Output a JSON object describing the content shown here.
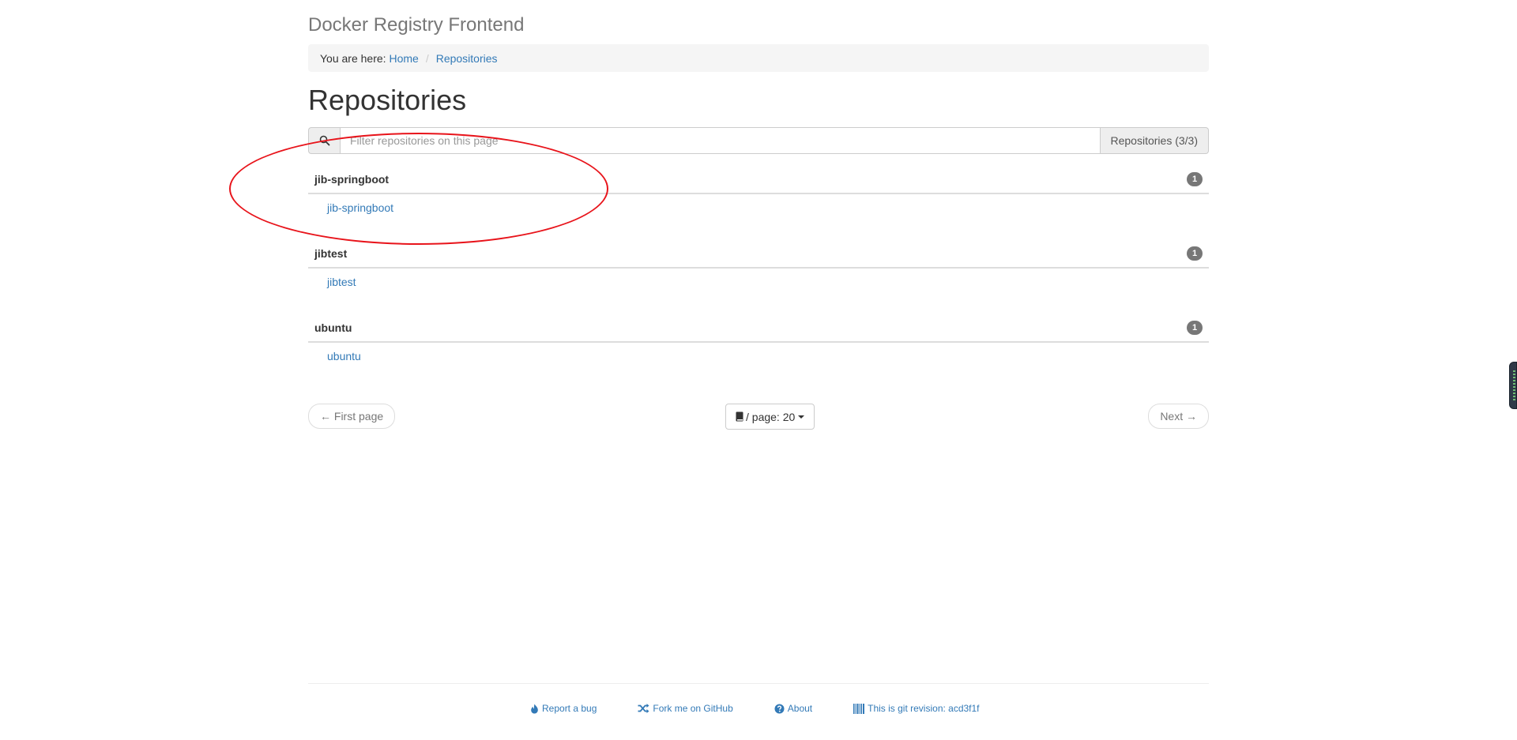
{
  "app": {
    "title": "Docker Registry Frontend"
  },
  "breadcrumb": {
    "prefix": "You are here:",
    "items": [
      "Home",
      "Repositories"
    ],
    "separator": "/"
  },
  "page": {
    "title": "Repositories"
  },
  "filter": {
    "placeholder": "Filter repositories on this page",
    "value": "",
    "count_label": "Repositories (3/3)",
    "icon": "search-icon"
  },
  "repositories": [
    {
      "namespace": "jib-springboot",
      "count": "1",
      "repo": "jib-springboot"
    },
    {
      "namespace": "jibtest",
      "count": "1",
      "repo": "jibtest"
    },
    {
      "namespace": "ubuntu",
      "count": "1",
      "repo": "ubuntu"
    }
  ],
  "pager": {
    "first_label": "← First page",
    "per_page_label": "/ page: 20",
    "next_label": "Next →"
  },
  "footer": {
    "links": [
      {
        "label": "Report a bug",
        "icon": "fire-icon"
      },
      {
        "label": "Fork me on GitHub",
        "icon": "random-icon"
      },
      {
        "label": "About",
        "icon": "question-circle-icon"
      },
      {
        "label": "This is git revision: acd3f1f",
        "icon": "barcode-icon"
      }
    ]
  },
  "colors": {
    "link": "#337ab7",
    "badge": "#777777",
    "annotation": "#e8141b",
    "breadcrumb_bg": "#f5f5f5"
  }
}
